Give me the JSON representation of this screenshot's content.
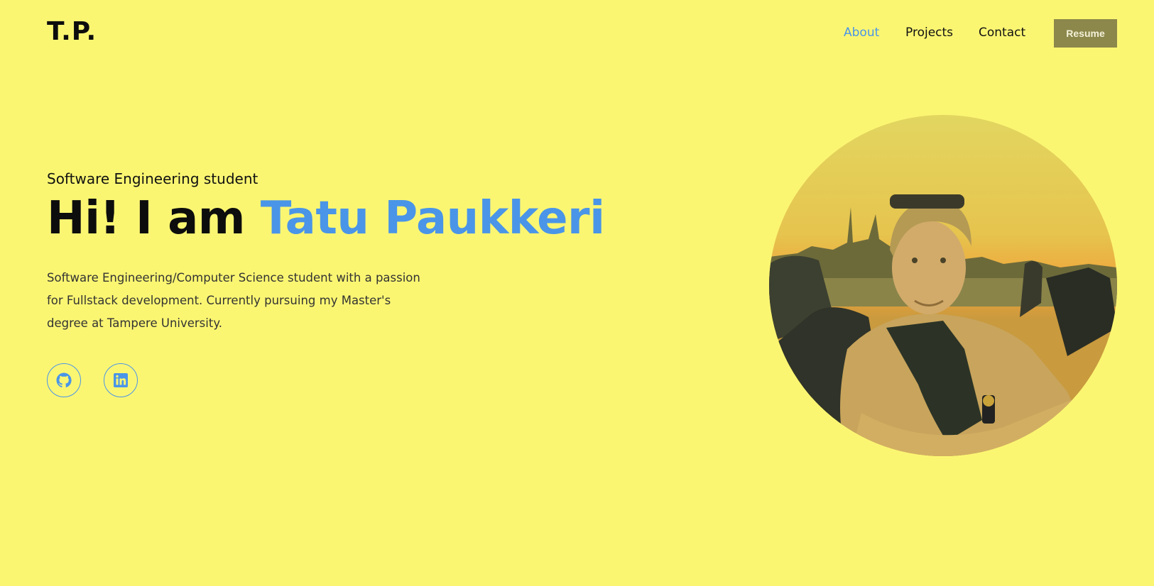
{
  "header": {
    "logo": "T.P.",
    "nav": [
      {
        "label": "About",
        "active": true
      },
      {
        "label": "Projects",
        "active": false
      },
      {
        "label": "Contact",
        "active": false
      }
    ],
    "resume_label": "Resume"
  },
  "hero": {
    "subtitle": "Software Engineering student",
    "greeting": "Hi! I am ",
    "name": "Tatu Paukkeri",
    "bio": "Software Engineering/Computer Science student with a passion for Fullstack development. Currently pursuing my Master's degree at Tampere University."
  },
  "socials": [
    {
      "icon": "github-icon"
    },
    {
      "icon": "linkedin-icon"
    }
  ],
  "colors": {
    "background": "#fbf672",
    "accent": "#4a95e8",
    "resume_button": "#8c874b"
  }
}
